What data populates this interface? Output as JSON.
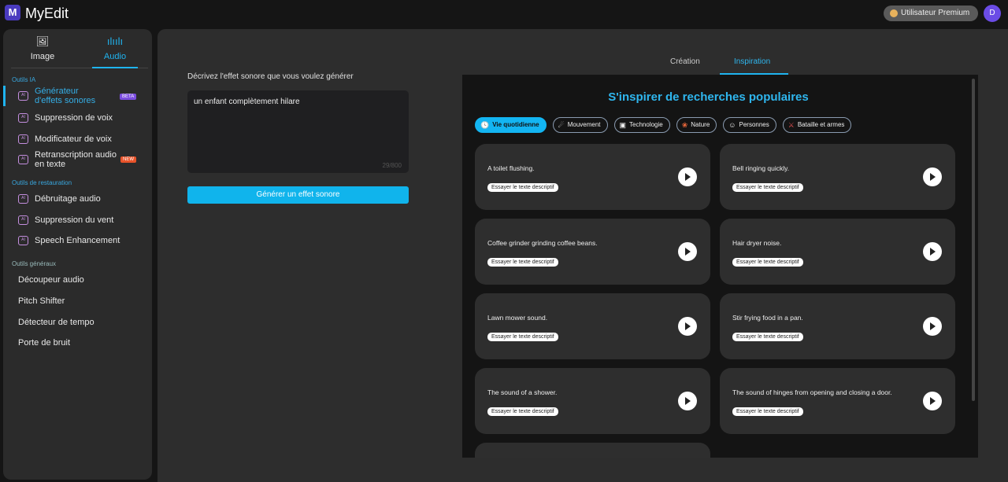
{
  "app": {
    "logo": "M",
    "name": "MyEdit",
    "premium": "Utilisateur Premium",
    "avatar": "D"
  },
  "sidebar": {
    "modes": [
      {
        "label": "Image",
        "icon": "image-icon"
      },
      {
        "label": "Audio",
        "icon": "waveform-icon"
      }
    ],
    "sections": {
      "ai": "Outils IA",
      "restore": "Outils de restauration",
      "general": "Outils généraux"
    },
    "ai_items": [
      {
        "label": "Générateur d'effets sonores",
        "badge": "BETA"
      },
      {
        "label": "Suppression de voix"
      },
      {
        "label": "Modificateur de voix"
      },
      {
        "label": "Retranscription audio en texte",
        "badge": "NEW"
      }
    ],
    "restore_items": [
      "Débruitage audio",
      "Suppression du vent",
      "Speech Enhancement"
    ],
    "general_items": [
      "Découpeur audio",
      "Pitch Shifter",
      "Détecteur de tempo",
      "Porte de bruit"
    ]
  },
  "editor": {
    "label": "Décrivez l'effet sonore que vous voulez générer",
    "value": "un enfant complètement hilare",
    "counter": "29/800",
    "generate": "Générer un effet sonore"
  },
  "tabs": [
    "Création",
    "Inspiration"
  ],
  "inspiration": {
    "title": "S'inspirer de recherches populaires",
    "chips": [
      {
        "label": "Vie quotidienne",
        "icon": "🕓"
      },
      {
        "label": "Mouvement",
        "icon": "☄"
      },
      {
        "label": "Technologie",
        "icon": "▣"
      },
      {
        "label": "Nature",
        "icon": "❀"
      },
      {
        "label": "Personnes",
        "icon": "☺"
      },
      {
        "label": "Bataille et armes",
        "icon": "⚔"
      }
    ],
    "try_label": "Essayer le texte descriptif",
    "cards": [
      "A toilet flushing.",
      "Bell ringing quickly.",
      "Coffee grinder grinding coffee beans.",
      "Hair dryer noise.",
      "Lawn mower sound.",
      "Stir frying food in a pan.",
      "The sound of a shower.",
      "The sound of hinges from opening and closing a door."
    ]
  },
  "colors": {
    "accent": "#10b4ec",
    "beta": "#7b4de0",
    "new": "#e8532a"
  }
}
